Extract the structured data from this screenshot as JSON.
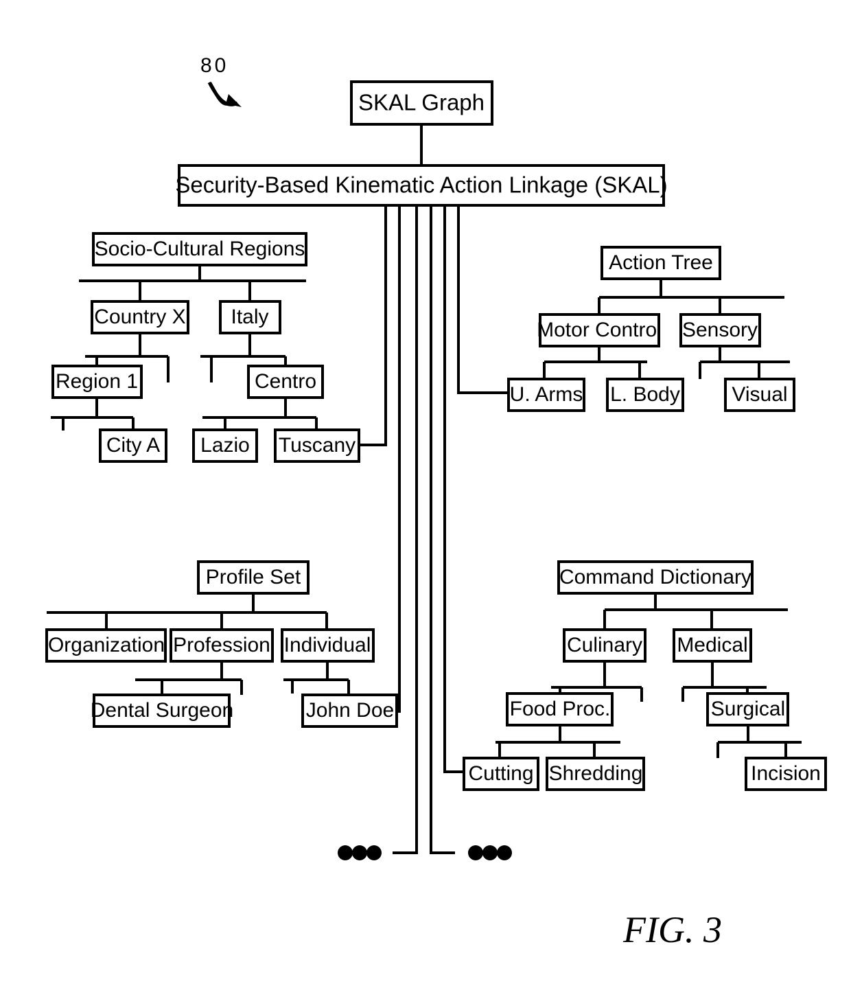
{
  "figure": {
    "caption": "FIG. 3",
    "reference_numeral": "80"
  },
  "nodes": {
    "root": "SKAL Graph",
    "skal": "Security-Based Kinematic Action Linkage (SKAL)",
    "socio_cultural": "Socio-Cultural Regions",
    "country_x": "Country X",
    "italy": "Italy",
    "region_1": "Region 1",
    "centro": "Centro",
    "city_a": "City A",
    "lazio": "Lazio",
    "tuscany": "Tuscany",
    "action_tree": "Action Tree",
    "motor_control": "Motor Control",
    "sensory": "Sensory",
    "u_arms": "U. Arms",
    "l_body": "L. Body",
    "visual": "Visual",
    "profile_set": "Profile Set",
    "organization": "Organization",
    "profession": "Profession",
    "individual": "Individual",
    "dental_surgeon": "Dental Surgeon",
    "john_doe": "John Doe",
    "command_dictionary": "Command Dictionary",
    "culinary": "Culinary",
    "medical": "Medical",
    "food_proc": "Food Proc.",
    "surgical": "Surgical",
    "cutting": "Cutting",
    "shredding": "Shredding",
    "incision": "Incision"
  },
  "ellipsis": {
    "left": "•••",
    "right": "•••"
  },
  "colors": {
    "stroke": "#000000",
    "fill": "#ffffff",
    "text": "#000000"
  }
}
